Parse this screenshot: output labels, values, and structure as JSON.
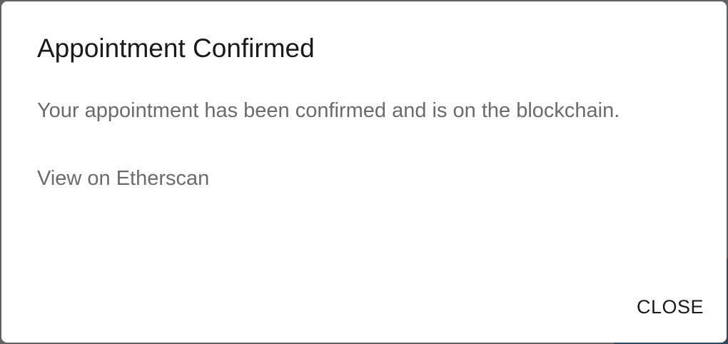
{
  "dialog": {
    "title": "Appointment Confirmed",
    "message": "Your appointment has been confirmed and is on the blockchain.",
    "link_label": "View on Etherscan",
    "close_label": "CLOSE"
  }
}
